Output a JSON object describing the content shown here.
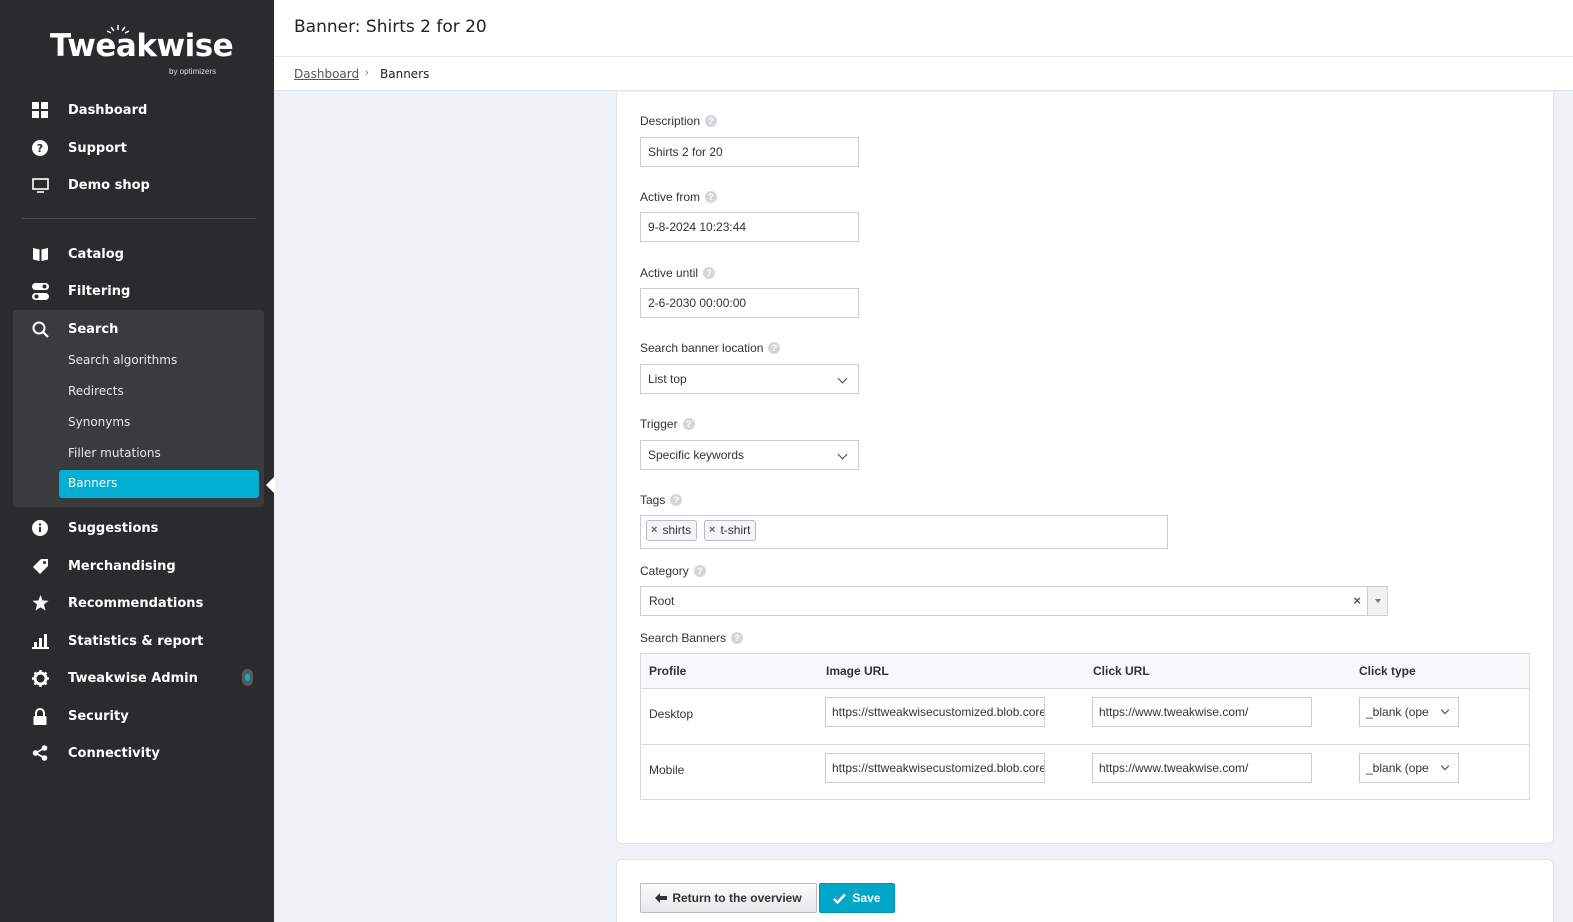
{
  "brand": {
    "name": "Tweakwise",
    "tagline": "by optimizers",
    "accent": "#00afd3"
  },
  "nav": {
    "top": [
      {
        "label": "Dashboard",
        "icon": "grid-icon"
      },
      {
        "label": "Support",
        "icon": "question-icon"
      },
      {
        "label": "Demo shop",
        "icon": "monitor-icon"
      }
    ],
    "main": [
      {
        "label": "Catalog",
        "icon": "book-icon"
      },
      {
        "label": "Filtering",
        "icon": "toggle-icon"
      },
      {
        "label": "Search",
        "icon": "search-icon"
      }
    ],
    "search_sub": [
      "Search algorithms",
      "Redirects",
      "Synonyms",
      "Filler mutations",
      "Banners"
    ],
    "bottom": [
      {
        "label": "Suggestions",
        "icon": "info-icon"
      },
      {
        "label": "Merchandising",
        "icon": "tag-icon"
      },
      {
        "label": "Recommendations",
        "icon": "star-icon"
      },
      {
        "label": "Statistics & report",
        "icon": "bar-chart-icon"
      },
      {
        "label": "Tweakwise Admin",
        "icon": "gear-icon"
      },
      {
        "label": "Security",
        "icon": "lock-icon"
      },
      {
        "label": "Connectivity",
        "icon": "share-icon"
      }
    ]
  },
  "header": {
    "title": "Banner: Shirts 2 for 20"
  },
  "breadcrumb": {
    "parent": "Dashboard",
    "separator": "›",
    "current": "Banners"
  },
  "form": {
    "description": {
      "label": "Description",
      "value": "Shirts 2 for 20"
    },
    "active_from": {
      "label": "Active from",
      "value": "9-8-2024 10:23:44"
    },
    "active_until": {
      "label": "Active until",
      "value": "2-6-2030 00:00:00"
    },
    "location": {
      "label": "Search banner location",
      "value": "List top"
    },
    "trigger": {
      "label": "Trigger",
      "value": "Specific keywords"
    },
    "tags": {
      "label": "Tags",
      "items": [
        "shirts",
        "t-shirt"
      ]
    },
    "category": {
      "label": "Category",
      "value": "Root",
      "clear": "×"
    },
    "banners": {
      "label": "Search Banners",
      "columns": [
        "Profile",
        "Image URL",
        "Click URL",
        "Click type"
      ],
      "rows": [
        {
          "profile": "Desktop",
          "image_url": "https://sttweakwisecustomized.blob.core",
          "click_url": "https://www.tweakwise.com/",
          "click_type": "_blank (ope"
        },
        {
          "profile": "Mobile",
          "image_url": "https://sttweakwisecustomized.blob.core",
          "click_url": "https://www.tweakwise.com/",
          "click_type": "_blank (ope"
        }
      ]
    }
  },
  "actions": {
    "return_label": "Return to the overview",
    "save_label": "Save"
  }
}
